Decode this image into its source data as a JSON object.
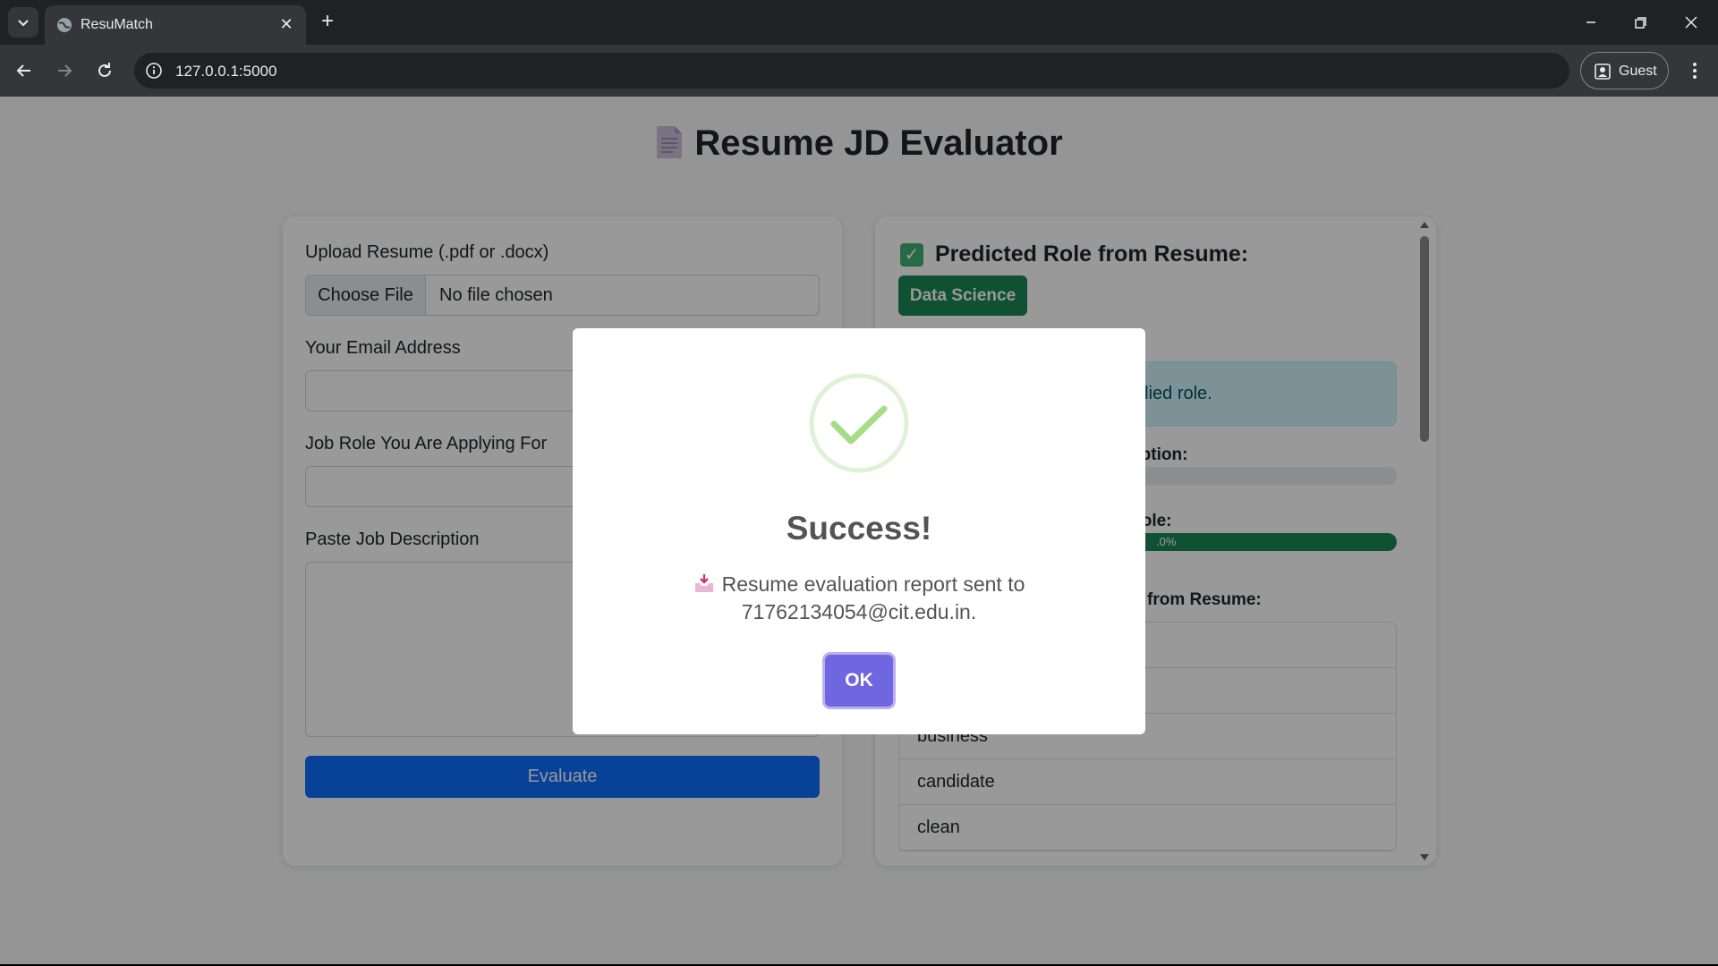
{
  "browser": {
    "tab_title": "ResuMatch",
    "url": "127.0.0.1:5000",
    "profile_label": "Guest"
  },
  "page": {
    "title": "Resume JD Evaluator"
  },
  "form": {
    "upload_label": "Upload Resume (.pdf or .docx)",
    "file_button": "Choose File",
    "file_status": "No file chosen",
    "email_label": "Your Email Address",
    "role_label": "Job Role You Are Applying For",
    "jd_label": "Paste Job Description",
    "evaluate_label": "Evaluate"
  },
  "results": {
    "check_glyph": "✓",
    "predicted_heading": "Predicted Role from Resume:",
    "predicted_role": "Data Science",
    "alert_partial": "plied role.",
    "jd_match_partial": "ription:",
    "role_match_partial": "Role:",
    "role_match_text_partial": ".0%",
    "skills_partial": "from Resume:",
    "jd_match_fraction": 0.01,
    "role_match_fraction": 1.0,
    "skills": [
      "",
      "",
      "business",
      "candidate",
      "clean"
    ],
    "colors": {
      "success": "#198754",
      "danger": "#dc3545",
      "info_bg": "#cff4fc"
    }
  },
  "dialog": {
    "title": "Success!",
    "message": "Resume evaluation report sent to 71762134054@cit.edu.in.",
    "ok_label": "OK",
    "accent": "#7066e0"
  }
}
